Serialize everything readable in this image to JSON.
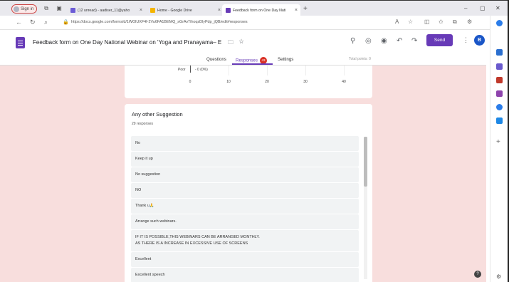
{
  "browser": {
    "profile_label": "Sign in",
    "tabs": [
      {
        "label": "(12 unread) - aadiser_11@yaho",
        "active": false
      },
      {
        "label": "Home - Google Drive",
        "active": false
      },
      {
        "label": "Feedback form on One Day Nati",
        "active": true
      }
    ],
    "new_tab": "+",
    "url": "https://docs.google.com/forms/d/1WOlUXF4f-2Vu6FA1BEMQ_sGrAvTihoqsDlyPdp_jQB/edit#responses",
    "window_controls": {
      "minimize": "–",
      "maximize": "▢",
      "close": "✕"
    }
  },
  "form": {
    "title": "Feedback form on One Day National Webinar on 'Yoga and Pranayama– E",
    "send_label": "Send",
    "avatar_initial": "B",
    "tabs": {
      "questions": "Questions",
      "responses": "Responses",
      "settings": "Settings"
    },
    "response_badge": "43",
    "total_points": "Total points: 0"
  },
  "chart_data": {
    "type": "bar",
    "categories": [
      "Poor"
    ],
    "value_labels": [
      "0 (0%)"
    ],
    "values": [
      0
    ],
    "xlim": [
      0,
      40
    ],
    "xticks": [
      "0",
      "10",
      "20",
      "30",
      "40"
    ]
  },
  "suggestions": {
    "title": "Any other Suggestion",
    "count": "29 responses",
    "responses": [
      "No",
      "Keep it up",
      "No suggestion",
      "NO",
      "Thank u🙏",
      "Arrange such webinars.",
      "IF IT IS POSSIBLE,THIS WEBINARS CAN BE ARRANGED MONTHLY.\nAS THERE IS A INCREASE IN EXCESSIVE USE OF SCREENS",
      "Excellent",
      "Excellent speech"
    ]
  },
  "help": "?"
}
